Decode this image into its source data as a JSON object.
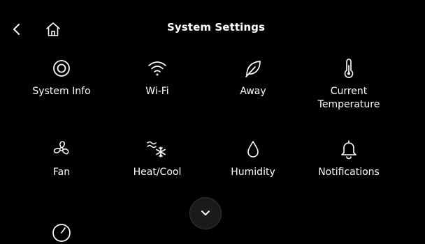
{
  "header": {
    "title": "System Settings",
    "back_icon": "chevron-left-icon",
    "home_icon": "home-icon"
  },
  "tiles": [
    {
      "label": "System Info",
      "icon": "target-circle-icon"
    },
    {
      "label": "Wi-Fi",
      "icon": "wifi-icon"
    },
    {
      "label": "Away",
      "icon": "leaf-icon"
    },
    {
      "label": "Current\nTemperature",
      "icon": "thermometer-icon"
    },
    {
      "label": "Fan",
      "icon": "fan-icon"
    },
    {
      "label": "Heat/Cool",
      "icon": "heat-cool-icon"
    },
    {
      "label": "Humidity",
      "icon": "droplet-icon"
    },
    {
      "label": "Notifications",
      "icon": "bell-icon"
    }
  ],
  "scroll": {
    "icon": "chevron-down-icon"
  },
  "colors": {
    "background": "#000000",
    "foreground": "#ffffff",
    "button_bg": "#1a1a1a"
  }
}
